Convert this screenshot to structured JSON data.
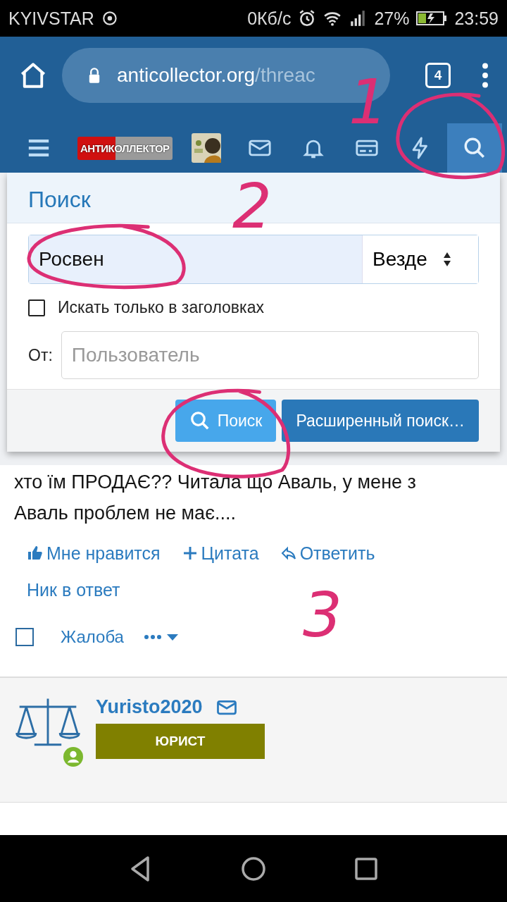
{
  "status_bar": {
    "carrier": "KYIVSTAR",
    "speed": "0Кб/с",
    "battery": "27%",
    "time": "23:59"
  },
  "browser": {
    "domain": "anticollector.org",
    "path": "/threac",
    "tab_count": "4"
  },
  "site_nav": {
    "logo": "АНТИКОЛЛЕКТОР",
    "items": [
      {
        "kind": "menu",
        "selected": false
      },
      {
        "kind": "avatar",
        "selected": false
      },
      {
        "kind": "mail",
        "selected": false
      },
      {
        "kind": "bell",
        "selected": false
      },
      {
        "kind": "card",
        "selected": false
      },
      {
        "kind": "bolt",
        "selected": false
      },
      {
        "kind": "search",
        "selected": true
      }
    ]
  },
  "search_popup": {
    "title": "Поиск",
    "query": "Росвен",
    "scope": "Везде",
    "titles_only": {
      "label": "Искать только в заголовках",
      "checked": false
    },
    "from_label": "От:",
    "user_placeholder": "Пользователь",
    "buttons": [
      {
        "kind": "primary",
        "label": "Поиск"
      },
      {
        "kind": "secondary",
        "label": "Расширенный поиск…"
      }
    ]
  },
  "post": {
    "text": "хто їм ПРОДАЄ?? Читала що Аваль, у мене з Аваль проблем не має....",
    "actions": [
      {
        "kind": "like",
        "label": "Мне нравится"
      },
      {
        "kind": "quote",
        "label": "Цитата"
      },
      {
        "kind": "reply",
        "label": "Ответить"
      },
      {
        "kind": "plain",
        "label": "Ник в ответ"
      }
    ],
    "selected": false,
    "report": "Жалоба"
  },
  "next_post": {
    "username": "Yuristo2020",
    "badge": "ЮРИСТ"
  },
  "annotations": [
    {
      "label": "1"
    },
    {
      "label": "2"
    },
    {
      "label": "3"
    }
  ]
}
